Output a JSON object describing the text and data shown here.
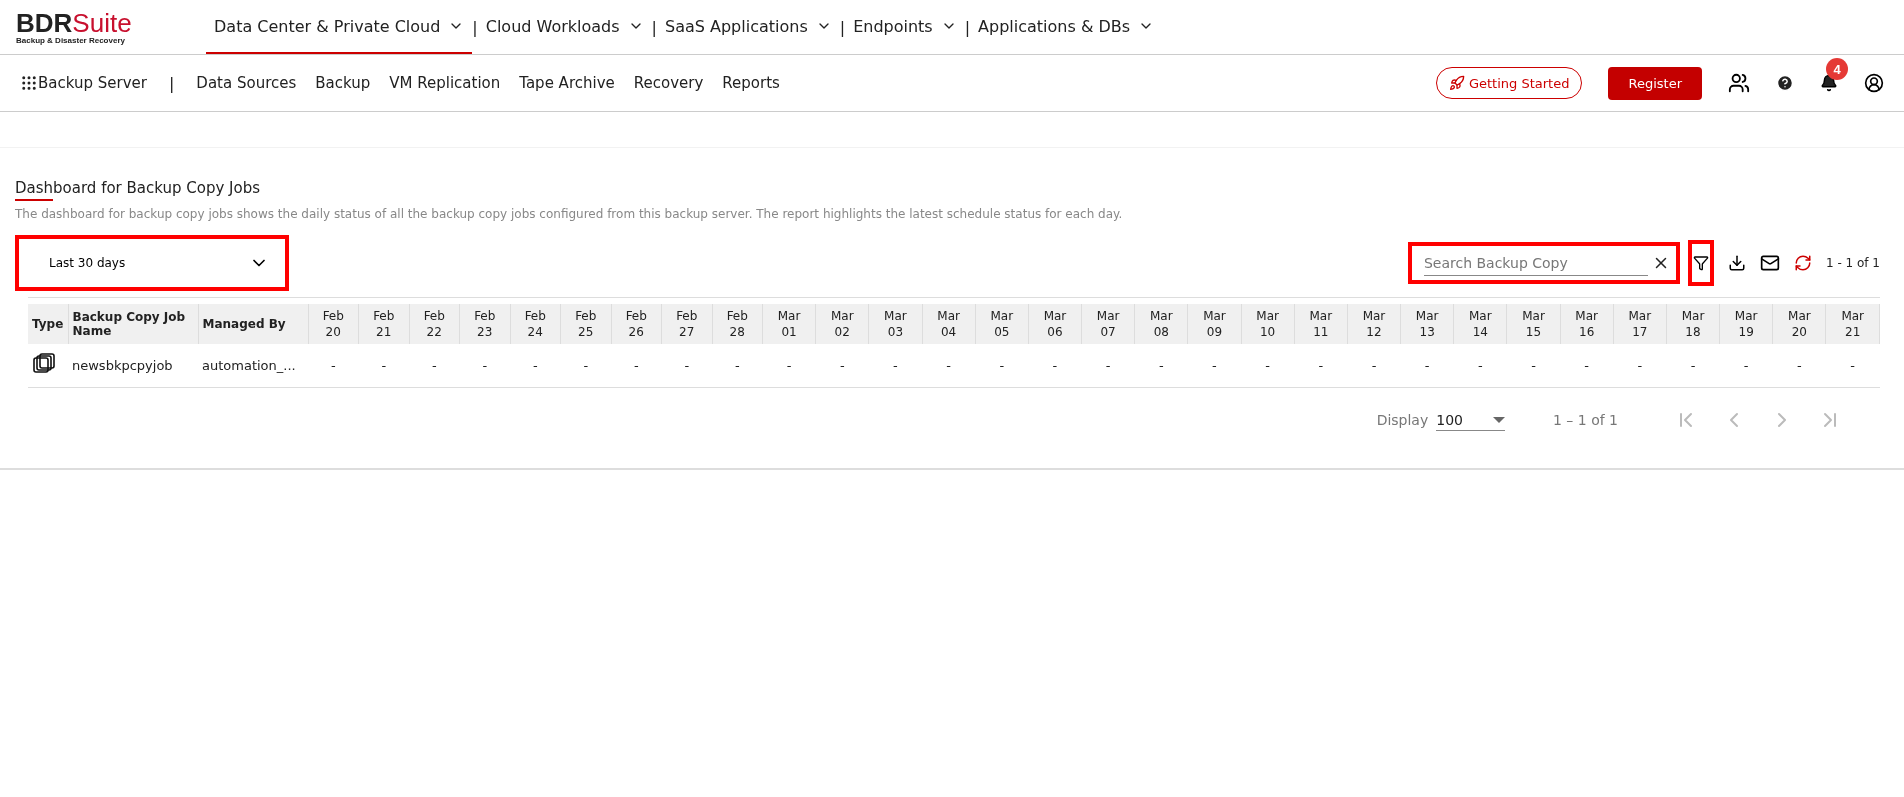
{
  "brand": {
    "name_dark": "BDR",
    "name_red": "Suite",
    "tagline": "Backup & Disaster Recovery"
  },
  "nav_separator": "|",
  "top_nav": [
    {
      "label": "Data Center & Private Cloud",
      "selected": true
    },
    {
      "label": "Cloud Workloads",
      "selected": false
    },
    {
      "label": "SaaS Applications",
      "selected": false
    },
    {
      "label": "Endpoints",
      "selected": false
    },
    {
      "label": "Applications & DBs",
      "selected": false
    }
  ],
  "sub_nav": {
    "title": "Backup Server",
    "items": [
      "Data Sources",
      "Backup",
      "VM Replication",
      "Tape Archive",
      "Recovery",
      "Reports"
    ]
  },
  "actions": {
    "getting_started": "Getting Started",
    "register": "Register",
    "notification_count": "4"
  },
  "dashboard": {
    "title": "Dashboard for Backup Copy Jobs",
    "description": "The dashboard for backup copy jobs shows the daily status of all the backup copy jobs configured from this backup server. The report highlights the latest schedule status for each day."
  },
  "period_select": {
    "value": "Last 30 days"
  },
  "search": {
    "placeholder": "Search Backup Copy"
  },
  "range": "1 - 1 of 1",
  "table": {
    "columns": [
      "Type",
      "Backup Copy Job Name",
      "Managed By"
    ],
    "dates": [
      [
        "Feb",
        "20"
      ],
      [
        "Feb",
        "21"
      ],
      [
        "Feb",
        "22"
      ],
      [
        "Feb",
        "23"
      ],
      [
        "Feb",
        "24"
      ],
      [
        "Feb",
        "25"
      ],
      [
        "Feb",
        "26"
      ],
      [
        "Feb",
        "27"
      ],
      [
        "Feb",
        "28"
      ],
      [
        "Mar",
        "01"
      ],
      [
        "Mar",
        "02"
      ],
      [
        "Mar",
        "03"
      ],
      [
        "Mar",
        "04"
      ],
      [
        "Mar",
        "05"
      ],
      [
        "Mar",
        "06"
      ],
      [
        "Mar",
        "07"
      ],
      [
        "Mar",
        "08"
      ],
      [
        "Mar",
        "09"
      ],
      [
        "Mar",
        "10"
      ],
      [
        "Mar",
        "11"
      ],
      [
        "Mar",
        "12"
      ],
      [
        "Mar",
        "13"
      ],
      [
        "Mar",
        "14"
      ],
      [
        "Mar",
        "15"
      ],
      [
        "Mar",
        "16"
      ],
      [
        "Mar",
        "17"
      ],
      [
        "Mar",
        "18"
      ],
      [
        "Mar",
        "19"
      ],
      [
        "Mar",
        "20"
      ],
      [
        "Mar",
        "21"
      ]
    ],
    "rows": [
      {
        "name": "newsbkpcpyjob",
        "managed_by": "automation_...",
        "statuses": [
          "-",
          "-",
          "-",
          "-",
          "-",
          "-",
          "-",
          "-",
          "-",
          "-",
          "-",
          "-",
          "-",
          "-",
          "-",
          "-",
          "-",
          "-",
          "-",
          "-",
          "-",
          "-",
          "-",
          "-",
          "-",
          "-",
          "-",
          "-",
          "-",
          "-"
        ]
      }
    ]
  },
  "pagination": {
    "display_label": "Display",
    "page_size": "100",
    "range": "1 – 1 of 1",
    "first_disabled": true,
    "prev_disabled": true,
    "next_disabled": true,
    "last_disabled": true
  }
}
